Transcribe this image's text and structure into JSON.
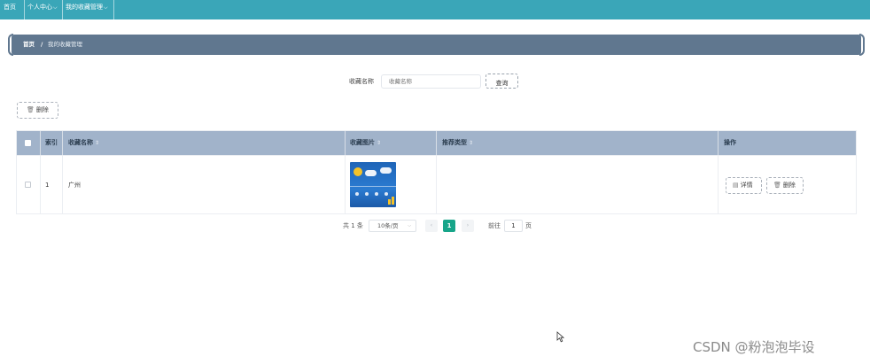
{
  "nav": {
    "items": [
      {
        "label": "首页",
        "has_caret": false
      },
      {
        "label": "个人中心",
        "has_caret": true
      },
      {
        "label": "我的收藏管理",
        "has_caret": true
      }
    ],
    "background": "#3aa6b8"
  },
  "breadcrumb": {
    "home": "首页",
    "separator": "/",
    "current": "我的收藏管理",
    "background": "#60778f"
  },
  "search": {
    "label": "收藏名称",
    "placeholder": "收藏名称",
    "button_label": "查询"
  },
  "toolbar": {
    "delete_label": "删除",
    "delete_icon": "trash-icon"
  },
  "table": {
    "columns": [
      "索引",
      "收藏名称",
      "收藏图片",
      "推荐类型",
      "操作"
    ],
    "sortable": [
      false,
      true,
      true,
      true,
      false
    ],
    "header_background": "#a1b3ca",
    "rows": [
      {
        "index": "1",
        "name": "广州",
        "image": "weather-forecast-thumbnail",
        "type": "",
        "actions": {
          "detail_label": "详情",
          "delete_label": "删除"
        }
      }
    ]
  },
  "pagination": {
    "total": "共 1 条",
    "page_size": "10条/页",
    "current_page": "1",
    "goto_label": "前往",
    "goto_value": "1",
    "page_suffix": "页",
    "active_color": "#17a589"
  },
  "watermark": "CSDN @粉泡泡毕设"
}
